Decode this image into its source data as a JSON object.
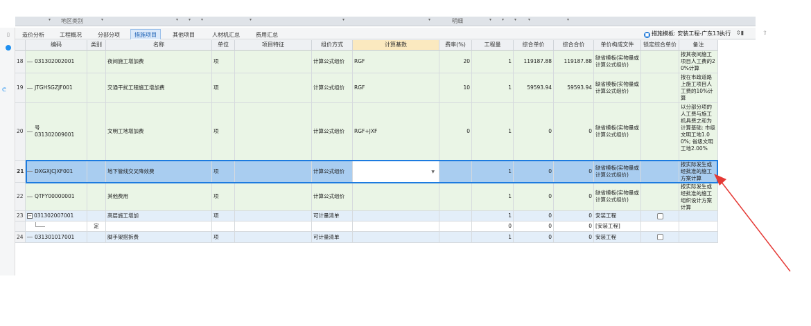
{
  "filterbar": {
    "labels": [
      "地区类别",
      "明细"
    ]
  },
  "tabs": [
    {
      "label": "造价分析",
      "active": false
    },
    {
      "label": "工程概况",
      "active": false
    },
    {
      "label": "分部分项",
      "active": false
    },
    {
      "label": "措施项目",
      "active": true
    },
    {
      "label": "其他项目",
      "active": false
    },
    {
      "label": "人材机汇总",
      "active": false
    },
    {
      "label": "费用汇总",
      "active": false
    }
  ],
  "template": {
    "icon": "template-icon",
    "label": "措施模板: 安装工程-广东13执行",
    "toggle": "⇕▮",
    "up": "⇧"
  },
  "columns": [
    "编码",
    "类别",
    "名称",
    "单位",
    "项目特征",
    "组价方式",
    "计算基数",
    "费率(%)",
    "工程量",
    "综合单价",
    "综合合价",
    "单价构成文件",
    "锁定综合单价",
    "备注"
  ],
  "rows": [
    {
      "num": "18",
      "code": "031302002001",
      "type": "",
      "name": "夜间施工增加费",
      "unit": "项",
      "feature": "",
      "method": "计算公式组价",
      "base": "RGF",
      "rate": "20",
      "qty": "1",
      "price": "119187.88",
      "total": "119187.88",
      "file": "缺省模板(实物量或计算公式组价)",
      "lock": "",
      "note": "按其夜间施工项目人工费的20%计算"
    },
    {
      "num": "19",
      "code": "JTGHSGZJF001",
      "type": "",
      "name": "交通干扰工程施工增加费",
      "unit": "项",
      "feature": "",
      "method": "计算公式组价",
      "base": "RGF",
      "rate": "10",
      "qty": "1",
      "price": "59593.94",
      "total": "59593.94",
      "file": "缺省模板(实物量或计算公式组价)",
      "lock": "",
      "note": "按在市政道路上施工项目人工费的10%计算"
    },
    {
      "num": "20",
      "code": "031302009001",
      "codePrefix": "号",
      "type": "",
      "name": "文明工地增加费",
      "unit": "项",
      "feature": "",
      "method": "计算公式组价",
      "base": "RGF+JXF",
      "rate": "0",
      "qty": "1",
      "price": "0",
      "total": "0",
      "file": "缺省模板(实物量或计算公式组价)",
      "lock": "",
      "note": "以分部分项的人工费与施工机具费之和为计算基础: 市级文明工地1.00%; 省级文明工地2.00%"
    },
    {
      "num": "21",
      "code": "DXGXJCJXF001",
      "type": "",
      "name": "地下管线交叉降效费",
      "unit": "项",
      "feature": "",
      "method": "计算公式组价",
      "base": "",
      "rate": "",
      "qty": "1",
      "price": "0",
      "total": "0",
      "file": "缺省模板(实物量或计算公式组价)",
      "lock": "",
      "note": "按实际发生或经批准的施工方案计算"
    },
    {
      "num": "22",
      "code": "QTFY00000001",
      "type": "",
      "name": "其他费用",
      "unit": "项",
      "feature": "",
      "method": "计算公式组价",
      "base": "",
      "rate": "",
      "qty": "1",
      "price": "0",
      "total": "0",
      "file": "缺省模板(实物量或计算公式组价)",
      "lock": "",
      "note": "按实际发生或经批准的施工组织设计方案计算"
    },
    {
      "num": "23",
      "code": "031302007001",
      "type": "",
      "name": "高层施工增加",
      "unit": "项",
      "feature": "",
      "method": "可计量清单",
      "base": "",
      "rate": "",
      "qty": "1",
      "price": "0",
      "total": "0",
      "file": "安装工程",
      "lock": "checkbox",
      "note": ""
    },
    {
      "num": "",
      "code": "",
      "type": "定",
      "name": "",
      "unit": "",
      "feature": "",
      "method": "",
      "base": "",
      "rate": "",
      "qty": "0",
      "price": "0",
      "total": "0",
      "file": "[安装工程]",
      "lock": "",
      "note": ""
    },
    {
      "num": "24",
      "code": "031301017001",
      "type": "",
      "name": "脚手架搭拆费",
      "unit": "项",
      "feature": "",
      "method": "可计量清单",
      "base": "",
      "rate": "",
      "qty": "1",
      "price": "0",
      "total": "0",
      "file": "安装工程",
      "lock": "checkbox",
      "note": ""
    }
  ],
  "colors": {
    "green_row": "#eaf5e6",
    "blue_row": "#e3eef9",
    "selected_row": "#a9cdf0",
    "selection_border": "#1c7be0",
    "header_highlight": "#fbe9bf",
    "arrow": "#e53935"
  }
}
